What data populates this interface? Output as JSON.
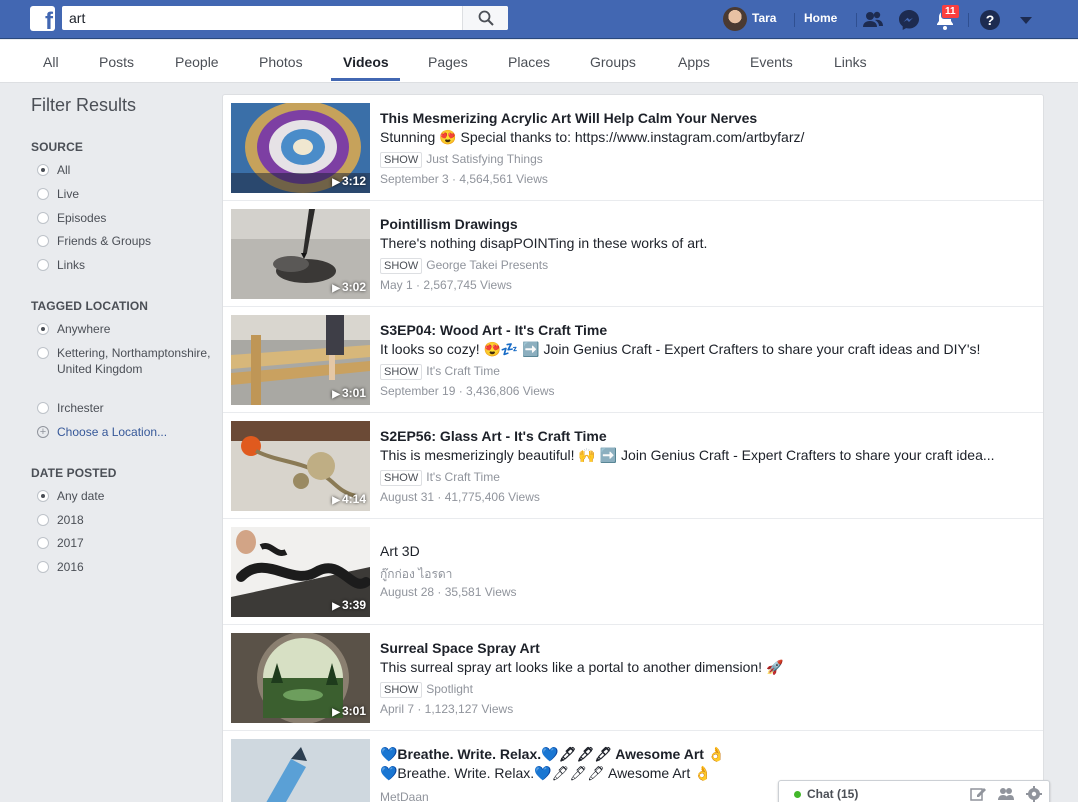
{
  "header": {
    "logo": "f",
    "search_value": "art",
    "user_name": "Tara",
    "home_label": "Home",
    "notification_count": "11",
    "brand_color": "#4267b2"
  },
  "tabs": [
    "All",
    "Posts",
    "People",
    "Photos",
    "Videos",
    "Pages",
    "Places",
    "Groups",
    "Apps",
    "Events",
    "Links"
  ],
  "active_tab": "Videos",
  "filters": {
    "title": "Filter Results",
    "source": {
      "heading": "SOURCE",
      "options": [
        "All",
        "Live",
        "Episodes",
        "Friends & Groups",
        "Links"
      ],
      "selected": "All"
    },
    "tagged_location": {
      "heading": "TAGGED LOCATION",
      "options": [
        "Anywhere",
        "Kettering, Northamptonshire, United Kingdom",
        "Irchester"
      ],
      "selected": "Anywhere",
      "choose_label": "Choose a Location..."
    },
    "date_posted": {
      "heading": "DATE POSTED",
      "options": [
        "Any date",
        "2018",
        "2017",
        "2016"
      ],
      "selected": "Any date"
    }
  },
  "results": [
    {
      "title": "This Mesmerizing Acrylic Art Will Help Calm Your Nerves",
      "description": "Stunning 😍 Special thanks to: https://www.instagram.com/artbyfarz/",
      "show_tag": "SHOW",
      "channel": "Just Satisfying Things",
      "meta": "September 3 · 4,564,561 Views",
      "duration": "3:12"
    },
    {
      "title": "Pointillism Drawings",
      "description": "There's nothing disapPOINTing in these works of art.",
      "show_tag": "SHOW",
      "channel": "George Takei Presents",
      "meta": "May 1 · 2,567,745 Views",
      "duration": "3:02"
    },
    {
      "title": "S3EP04: Wood Art - It's Craft Time",
      "description": "It looks so cozy! 😍💤 ➡️ Join Genius Craft - Expert Crafters to share your craft ideas and DIY's!",
      "show_tag": "SHOW",
      "channel": "It's Craft Time",
      "meta": "September 19 · 3,436,806 Views",
      "duration": "3:01"
    },
    {
      "title": "S2EP56: Glass Art - It's Craft Time",
      "description": "This is mesmerizingly beautiful! 🙌 ➡️ Join Genius Craft - Expert Crafters to share your craft idea...",
      "show_tag": "SHOW",
      "channel": "It's Craft Time",
      "meta": "August 31 · 41,775,406 Views",
      "duration": "4:14"
    },
    {
      "title": "Art 3D",
      "description": "",
      "show_tag": "",
      "channel": "กู๊กก่อง ไอรดา",
      "meta": "August 28 · 35,581 Views",
      "duration": "3:39"
    },
    {
      "title": "Surreal Space Spray Art",
      "description": "This surreal spray art looks like a portal to another dimension! 🚀",
      "show_tag": "SHOW",
      "channel": "Spotlight",
      "meta": "April 7 · 1,123,127 Views",
      "duration": "3:01"
    },
    {
      "title": "💙Breathe. Write. Relax.💙🖋🖋🖋 Awesome Art 👌",
      "description": "💙Breathe. Write. Relax.💙🖊🖊🖊 Awesome Art 👌",
      "show_tag": "",
      "channel": "MetDaan",
      "meta": "",
      "duration": ""
    }
  ],
  "chat": {
    "label": "Chat (15)",
    "status_color": "#42b72a"
  }
}
